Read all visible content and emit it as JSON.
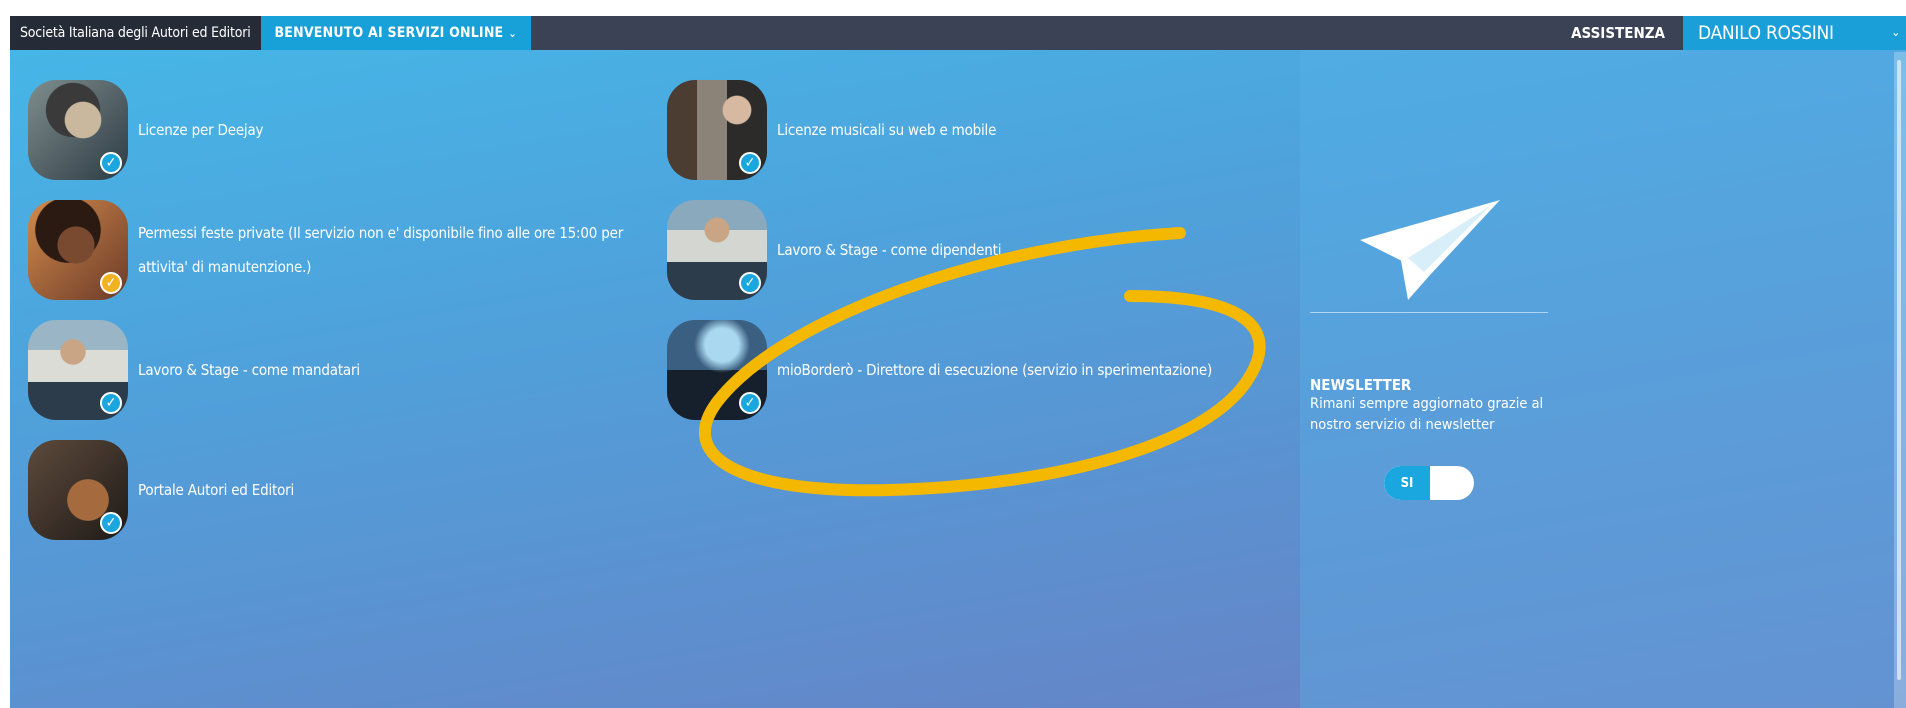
{
  "topbar": {
    "brand": "Società Italiana degli Autori ed Editori",
    "welcome": "BENVENUTO AI SERVIZI ONLINE",
    "assistance": "ASSISTENZA",
    "user": "DANILO ROSSINI"
  },
  "services": [
    {
      "label": "Licenze per Deejay",
      "badge": "✓",
      "badge_color": "#1aa7e0"
    },
    {
      "label": "Licenze musicali su web e mobile",
      "badge": "✓",
      "badge_color": "#1aa7e0"
    },
    {
      "label_line1": "Permessi feste private (Il servizio non e' disponibile fino alle ore 15:00 per",
      "label_line2": "attivita' di manutenzione.)",
      "badge": "✓",
      "badge_color": "#f0b21f"
    },
    {
      "label": "Lavoro & Stage - come dipendenti",
      "badge": "✓",
      "badge_color": "#1aa7e0"
    },
    {
      "label": "Lavoro & Stage - come mandatari",
      "badge": "✓",
      "badge_color": "#1aa7e0"
    },
    {
      "label": "mioBorderò - Direttore di esecuzione (servizio in sperimentazione)",
      "badge": "✓",
      "badge_color": "#1aa7e0"
    },
    {
      "label": "Portale Autori ed Editori",
      "badge": "✓",
      "badge_color": "#1aa7e0"
    }
  ],
  "newsletter": {
    "icon": "paper-plane-icon",
    "title": "NEWSLETTER",
    "description": "Rimani sempre aggiornato grazie al nostro servizio di newsletter",
    "toggle_label": "SI",
    "toggle_state": "on"
  },
  "colors": {
    "topbar": "#3b4256",
    "accent": "#1aa7e0",
    "annotation": "#f5b800"
  }
}
